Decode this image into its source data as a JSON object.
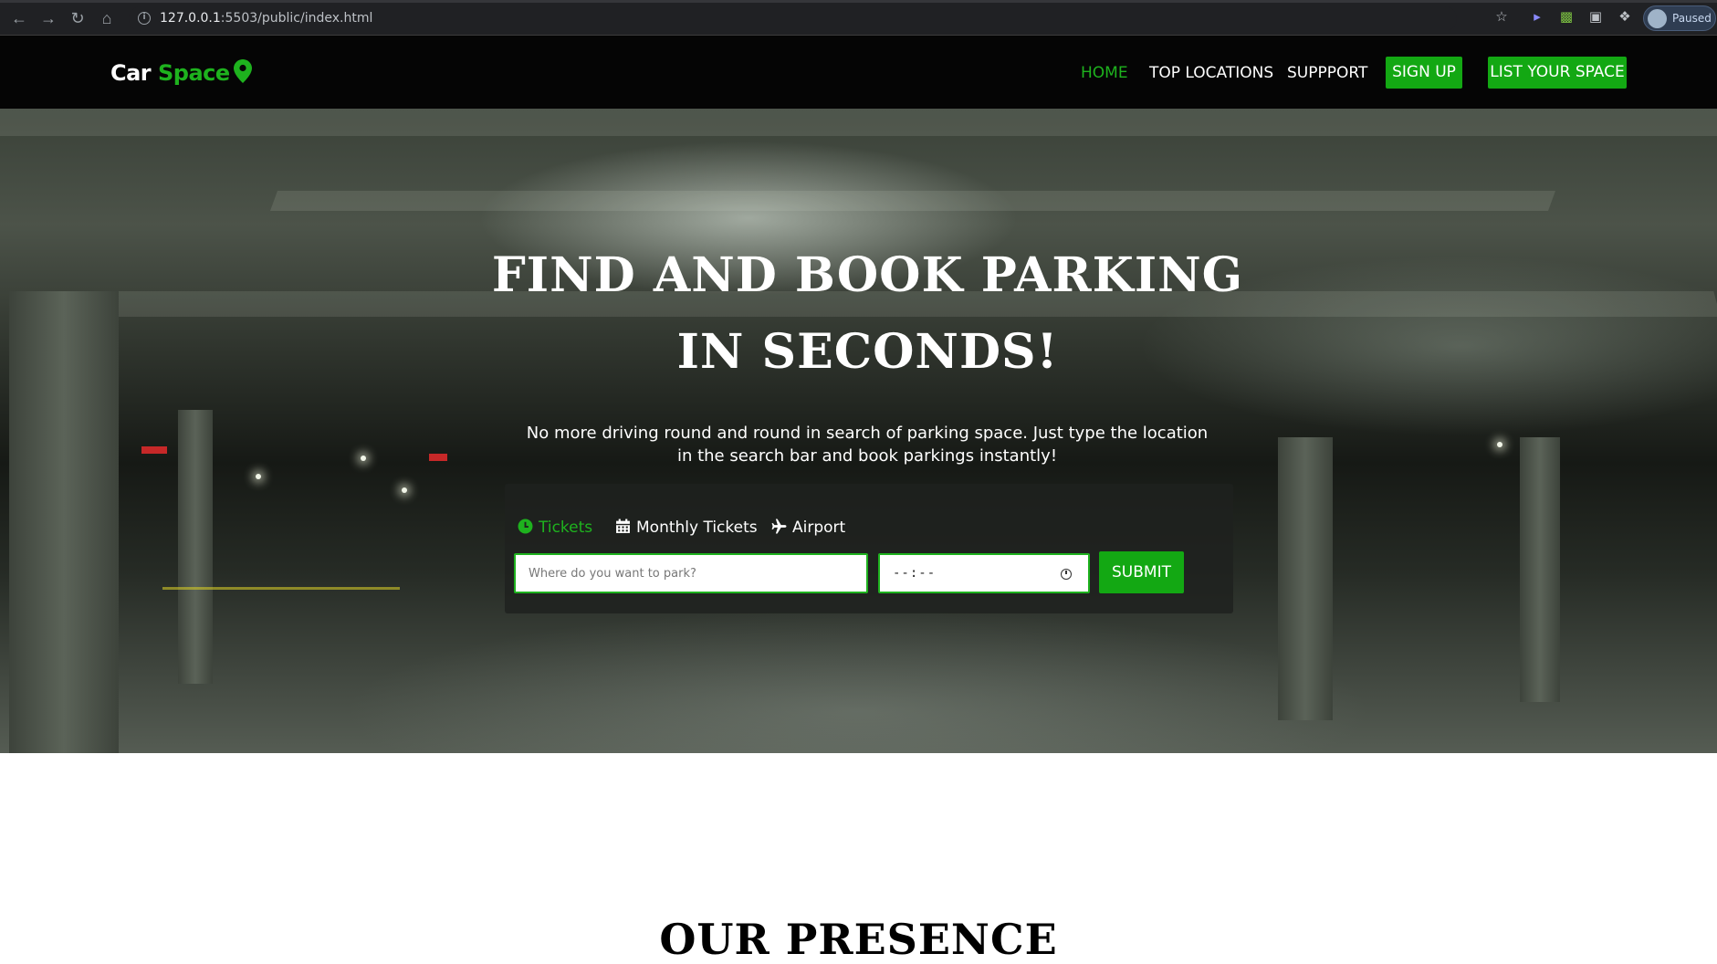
{
  "browser": {
    "url_host": "127.0.0.1",
    "url_rest": ":5503/public/index.html",
    "profile_status": "Paused",
    "icons": [
      "back-arrow-icon",
      "forward-arrow-icon",
      "reload-icon",
      "home-icon",
      "info-icon",
      "star-icon",
      "extension-icon",
      "puzzle-icon"
    ]
  },
  "brand": {
    "word1": "Car",
    "word2": "Space",
    "accent_color": "#1eb21e"
  },
  "nav": {
    "home": "HOME",
    "top_locations": "TOP LOCATIONS",
    "support": "SUPPPORT",
    "sign_up": "SIGN UP",
    "list_space": "LIST YOUR SPACE"
  },
  "hero": {
    "title_line1": "Find and Book Parking",
    "title_line2": "in seconds!",
    "subtitle": "No more driving round and round in search of parking space. Just type the location in the search bar and book parkings instantly!"
  },
  "search": {
    "tabs": [
      {
        "label": "Tickets",
        "icon": "clock-icon",
        "active": true
      },
      {
        "label": "Monthly Tickets",
        "icon": "calendar-icon",
        "active": false
      },
      {
        "label": "Airport",
        "icon": "plane-icon",
        "active": false
      }
    ],
    "location_placeholder": "Where do you want to park?",
    "time_value": "--:--",
    "submit_label": "SUBMIT"
  },
  "presence": {
    "title": "Our Presence"
  }
}
